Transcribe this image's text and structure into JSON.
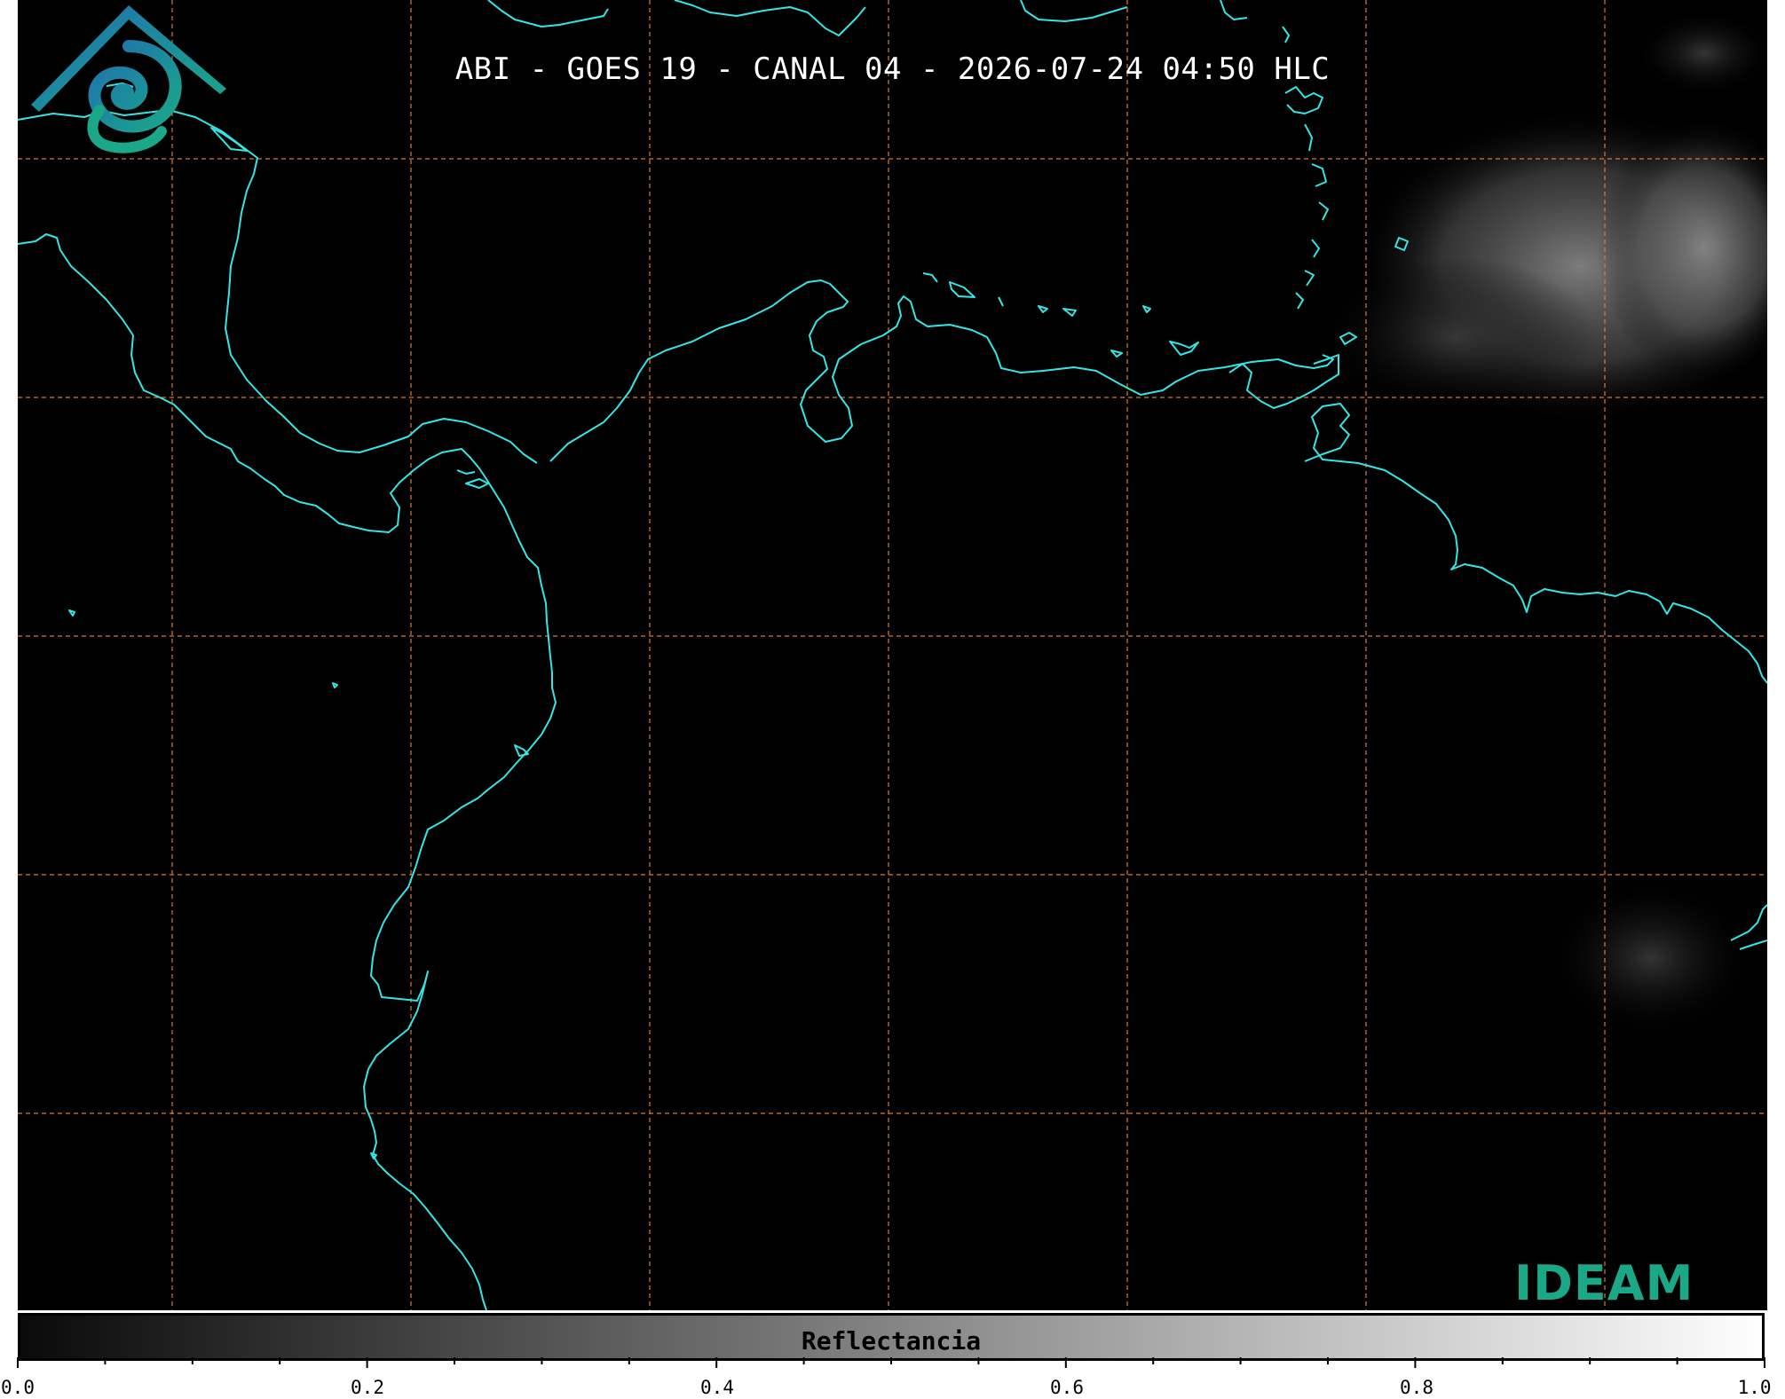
{
  "title": "ABI - GOES 19 - CANAL 04 - 2026-07-24 04:50 HLC",
  "colorbar": {
    "label": "Reflectancia",
    "min": 0.0,
    "max": 1.0,
    "major_ticks": [
      "0.0",
      "0.2",
      "0.4",
      "0.6",
      "0.8",
      "1.0"
    ],
    "minor_step": 0.05,
    "colormap": [
      "#000000",
      "#ffffff"
    ]
  },
  "map": {
    "background_color": "#000000",
    "coastline_color": "#33e6e6",
    "grid_color": "#e07a2a",
    "grid_style": "dashed"
  },
  "logo": {
    "text": "IDEAM",
    "colors": [
      "#1f6fb0",
      "#1aa889"
    ]
  }
}
